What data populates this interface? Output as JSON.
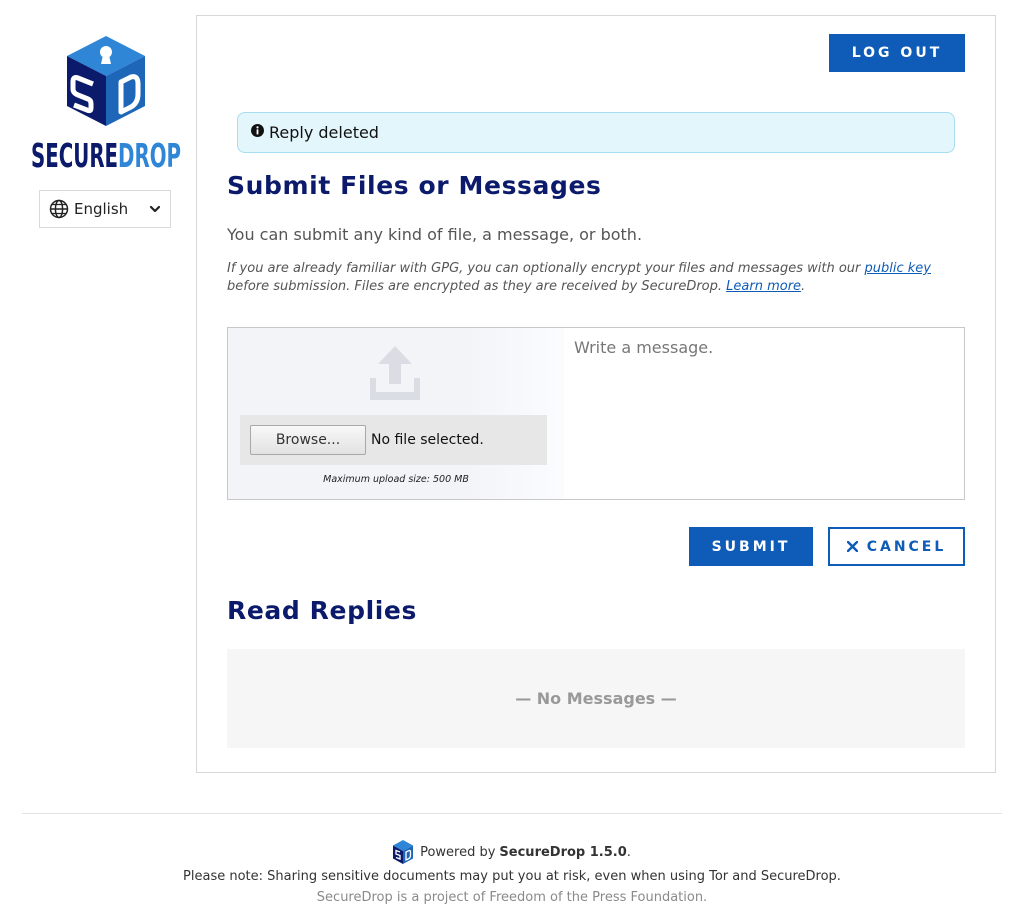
{
  "brand": {
    "logo_text": "SECUREDROP",
    "logo_monogram": "SD",
    "logo_icon": "securedrop-cube-icon",
    "color_dark": "#0b1a6b",
    "color_blue": "#1d66b8",
    "color_light_blue": "#2f86d6"
  },
  "language": {
    "icon": "globe-icon",
    "selected": "English",
    "chevron_icon": "chevron-down-icon"
  },
  "header": {
    "logout_label": "LOG OUT"
  },
  "flash": {
    "icon": "info-icon",
    "text": "Reply deleted"
  },
  "submit_section": {
    "title": "Submit Files or Messages",
    "lead": "You can submit any kind of file, a message, or both.",
    "gpg_before": "If you are already familiar with GPG, you can optionally encrypt your files and messages with our ",
    "gpg_link": "public key",
    "gpg_middle": " before submission. Files are encrypted as they are received by SecureDrop. ",
    "learn_more": "Learn more",
    "gpg_after": ".",
    "upload_icon": "upload-icon",
    "browse_label": "Browse...",
    "file_status": "No file selected.",
    "max_size": "Maximum upload size: 500 MB",
    "message_placeholder": "Write a message.",
    "message_value": "",
    "submit_label": "SUBMIT",
    "cancel_label": "CANCEL",
    "cancel_icon": "close-icon"
  },
  "replies_section": {
    "title": "Read Replies",
    "empty_text": "— No Messages —"
  },
  "footer": {
    "powered_prefix": "Powered by",
    "powered_product": "SecureDrop 1.5.0",
    "powered_suffix": ".",
    "risk_note": "Please note: Sharing sensitive documents may put you at risk, even when using Tor and SecureDrop.",
    "project_note": "SecureDrop is a project of Freedom of the Press Foundation."
  },
  "colors": {
    "primary_button": "#0e5cb7",
    "heading": "#0b1a6b",
    "flash_bg": "#e3f6fc",
    "flash_border": "#a8dcf0"
  }
}
